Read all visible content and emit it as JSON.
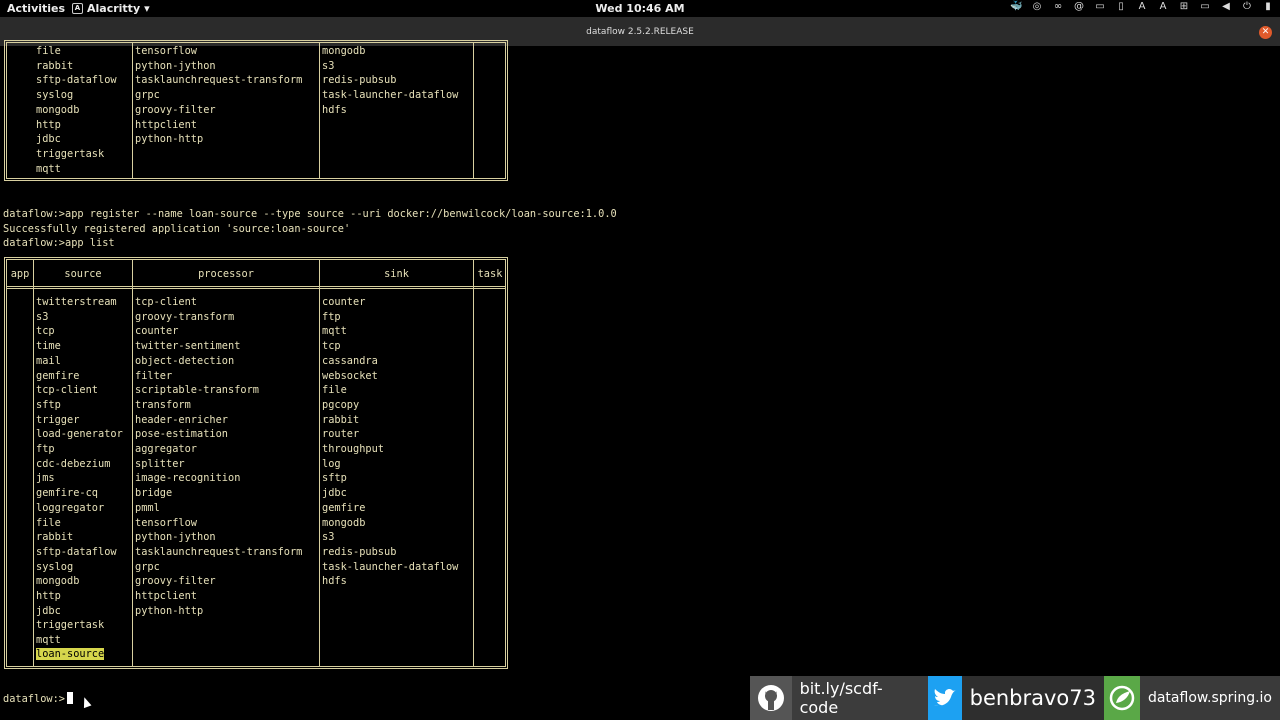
{
  "topbar": {
    "activities": "Activities",
    "app_name": "Alacritty",
    "clock": "Wed 10:46 AM"
  },
  "window": {
    "title": "dataflow 2.5.2.RELEASE"
  },
  "terminal": {
    "prev_table_rows": [
      [
        "file",
        "tensorflow",
        "mongodb",
        ""
      ],
      [
        "rabbit",
        "python-jython",
        "s3",
        ""
      ],
      [
        "sftp-dataflow",
        "tasklaunchrequest-transform",
        "redis-pubsub",
        ""
      ],
      [
        "syslog",
        "grpc",
        "task-launcher-dataflow",
        ""
      ],
      [
        "mongodb",
        "groovy-filter",
        "hdfs",
        ""
      ],
      [
        "http",
        "httpclient",
        "",
        ""
      ],
      [
        "jdbc",
        "python-http",
        "",
        ""
      ],
      [
        "triggertask",
        "",
        "",
        ""
      ],
      [
        "mqtt",
        "",
        "",
        ""
      ]
    ],
    "cmd1": "dataflow:>app register --name loan-source --type source --uri docker://benwilcock/loan-source:1.0.0",
    "out1": "Successfully registered application 'source:loan-source'",
    "cmd2": "dataflow:>app list",
    "table_headers": [
      "app",
      "source",
      "processor",
      "sink",
      "task"
    ],
    "table_rows": [
      [
        "twitterstream",
        "tcp-client",
        "counter"
      ],
      [
        "s3",
        "groovy-transform",
        "ftp"
      ],
      [
        "tcp",
        "counter",
        "mqtt"
      ],
      [
        "time",
        "twitter-sentiment",
        "tcp"
      ],
      [
        "mail",
        "object-detection",
        "cassandra"
      ],
      [
        "gemfire",
        "filter",
        "websocket"
      ],
      [
        "tcp-client",
        "scriptable-transform",
        "file"
      ],
      [
        "sftp",
        "transform",
        "pgcopy"
      ],
      [
        "trigger",
        "header-enricher",
        "rabbit"
      ],
      [
        "load-generator",
        "pose-estimation",
        "router"
      ],
      [
        "ftp",
        "aggregator",
        "throughput"
      ],
      [
        "cdc-debezium",
        "splitter",
        "log"
      ],
      [
        "jms",
        "image-recognition",
        "sftp"
      ],
      [
        "gemfire-cq",
        "bridge",
        "jdbc"
      ],
      [
        "loggregator",
        "pmml",
        "gemfire"
      ],
      [
        "file",
        "tensorflow",
        "mongodb"
      ],
      [
        "rabbit",
        "python-jython",
        "s3"
      ],
      [
        "sftp-dataflow",
        "tasklaunchrequest-transform",
        "redis-pubsub"
      ],
      [
        "syslog",
        "grpc",
        "task-launcher-dataflow"
      ],
      [
        "mongodb",
        "groovy-filter",
        "hdfs"
      ],
      [
        "http",
        "httpclient",
        ""
      ],
      [
        "jdbc",
        "python-http",
        ""
      ],
      [
        "triggertask",
        "",
        ""
      ],
      [
        "mqtt",
        "",
        ""
      ]
    ],
    "highlighted_source": "loan-source",
    "prompt": "dataflow:>"
  },
  "promo": {
    "github_link": "bit.ly/scdf-code",
    "twitter_handle": "benbravo73",
    "spring_site": "dataflow.spring.io",
    "icons": [
      "github-icon",
      "twitter-icon",
      "spring-icon"
    ]
  }
}
